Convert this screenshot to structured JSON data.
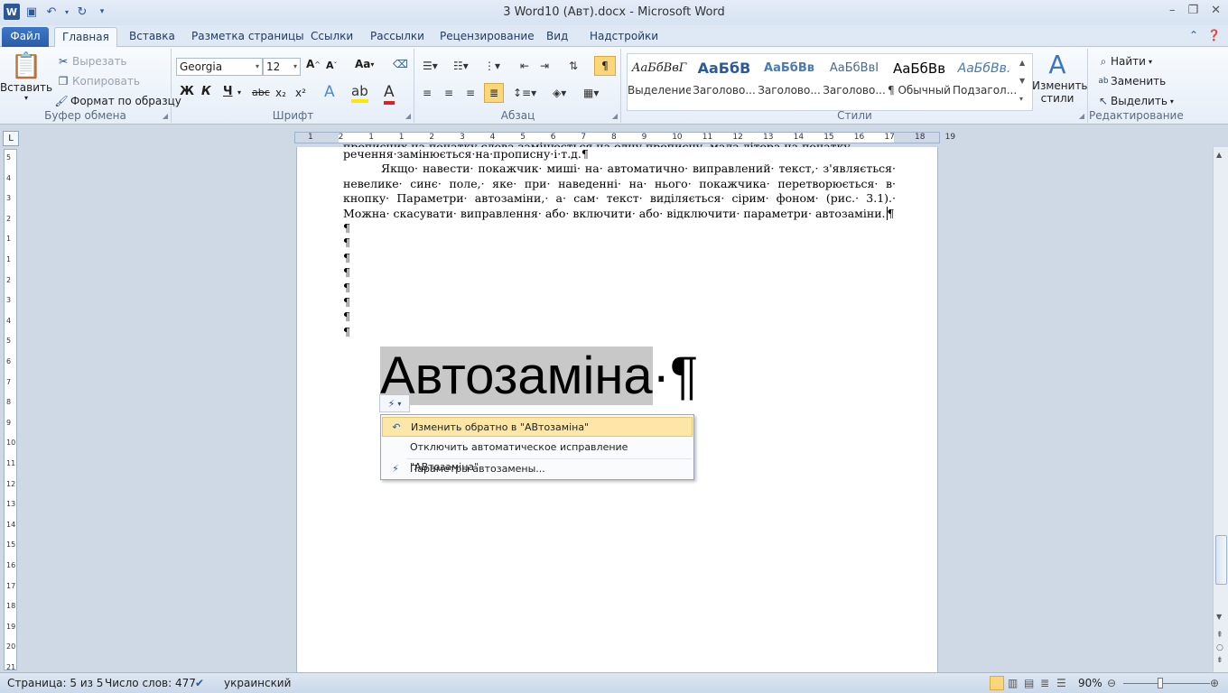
{
  "window": {
    "title": "3 Word10  (Авт).docx - Microsoft Word",
    "app_icon": "W"
  },
  "tabs": [
    "Файл",
    "Главная",
    "Вставка",
    "Разметка страницы",
    "Ссылки",
    "Рассылки",
    "Рецензирование",
    "Вид",
    "Надстройки"
  ],
  "active_tab": "Главная",
  "ribbon": {
    "clipboard": {
      "label": "Буфер обмена",
      "paste": "Вставить",
      "cut": "Вырезать",
      "copy": "Копировать",
      "format_painter": "Формат по образцу"
    },
    "font": {
      "label": "Шрифт",
      "font_name": "Georgia",
      "font_size": "12",
      "bold": "Ж",
      "italic": "К",
      "underline": "Ч",
      "strike": "abc"
    },
    "paragraph": {
      "label": "Абзац"
    },
    "styles": {
      "label": "Стили",
      "items": [
        {
          "preview": "АаБбВвГ",
          "name": "Выделение"
        },
        {
          "preview": "АаБбВ",
          "name": "Заголово..."
        },
        {
          "preview": "АаБбВв",
          "name": "Заголово..."
        },
        {
          "preview": "АаБбВвІ",
          "name": "Заголово..."
        },
        {
          "preview": "АаБбВв",
          "name": "¶ Обычный"
        },
        {
          "preview": "АаБбВв.",
          "name": "Подзагол..."
        }
      ],
      "change_styles": "Изменить стили"
    },
    "editing": {
      "label": "Редактирование",
      "find": "Найти",
      "replace": "Заменить",
      "select": "Выделить"
    }
  },
  "ruler": {
    "numbers": [
      "1",
      "2",
      "1",
      "1",
      "2",
      "3",
      "4",
      "5",
      "6",
      "7",
      "8",
      "9",
      "10",
      "11",
      "12",
      "13",
      "14",
      "15",
      "16",
      "17",
      "18",
      "19"
    ]
  },
  "vruler": {
    "numbers": [
      "5",
      "4",
      "3",
      "2",
      "1",
      "1",
      "2",
      "3",
      "4",
      "5",
      "6",
      "7",
      "8",
      "9",
      "10",
      "11",
      "12",
      "13",
      "14",
      "15",
      "16",
      "17",
      "18",
      "19",
      "20",
      "21"
    ]
  },
  "document": {
    "line_cut": "прописних на початку слова замінюється на одну прописну, мала літера на початку",
    "line_1": "речення·замінюється·на·прописну·і·т.д.¶",
    "paragraph": "Якщо· навести· покажчик· миші· на· автоматично· виправлений· текст,· з'являється· невелике· синє· поле,· яке· при· наведенні· на· нього· покажчика· перетворюється· в· кнопку· Параметри· автозаміни,· а· сам· текст· виділяється· сірим· фоном· (рис.· 3.1).· Можна· скасувати· виправлення· або· включити· або· відключити· параметри· автозаміни.",
    "paragraph_end": "¶",
    "empty_marks": [
      "¶",
      "¶",
      "¶",
      "¶",
      "¶",
      "¶",
      "¶",
      "¶"
    ],
    "big_text": "Автозаміна",
    "big_tail": "·¶"
  },
  "autocorrect_menu": {
    "items": [
      {
        "label": "Изменить обратно в \"АВтозаміна\"",
        "highlighted": true,
        "icon": "undo-icon"
      },
      {
        "label": "Отключить автоматическое исправление \"АВтозаміна\"",
        "highlighted": false,
        "icon": ""
      },
      {
        "label": "Параметры автозамены...",
        "highlighted": false,
        "icon": "autocorrect-options-icon"
      }
    ]
  },
  "status": {
    "page": "Страница: 5 из 5",
    "words": "Число слов: 477",
    "language": "украинский",
    "zoom": "90%"
  }
}
